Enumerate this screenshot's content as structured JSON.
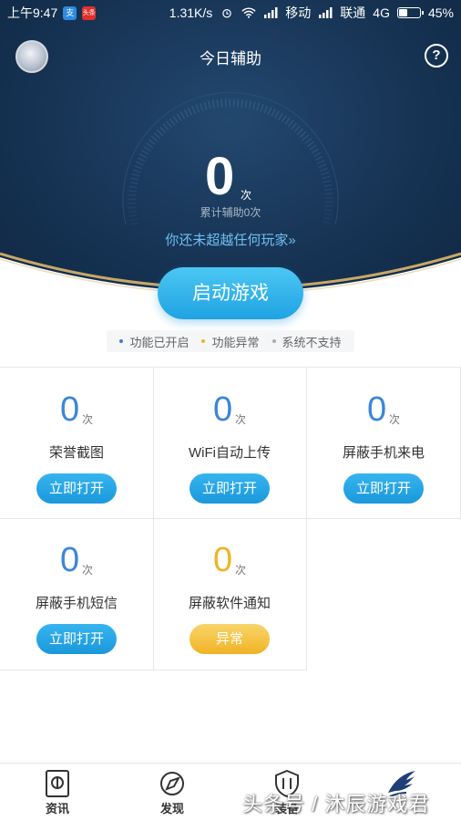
{
  "status_bar": {
    "time": "上午9:47",
    "app_badge_1": "支",
    "app_badge_2": "头条",
    "speed": "1.31K/s",
    "carrier_1": "移动",
    "carrier_2": "联通",
    "network": "4G",
    "battery": "45%",
    "battery_level": 0.45
  },
  "header": {
    "title": "今日辅助",
    "help_symbol": "?"
  },
  "assist_counter": {
    "count": "0",
    "unit": "次",
    "label": "累计辅助0次",
    "link_text": "你还未超越任何玩家",
    "link_arrow": "»"
  },
  "start_button": {
    "label": "启动游戏"
  },
  "legend": [
    {
      "label": "功能已开启",
      "color": "#3b79e0"
    },
    {
      "label": "功能异常",
      "color": "#f0b325"
    },
    {
      "label": "系统不支持",
      "color": "#aaaaaa"
    }
  ],
  "features": [
    {
      "count": "0",
      "unit": "次",
      "name": "荣誉截图",
      "action": "立即打开",
      "state": "open",
      "count_color": "#3b86d8"
    },
    {
      "count": "0",
      "unit": "次",
      "name": "WiFi自动上传",
      "action": "立即打开",
      "state": "open",
      "count_color": "#3b86d8"
    },
    {
      "count": "0",
      "unit": "次",
      "name": "屏蔽手机来电",
      "action": "立即打开",
      "state": "open",
      "count_color": "#3b86d8"
    },
    {
      "count": "0",
      "unit": "次",
      "name": "屏蔽手机短信",
      "action": "立即打开",
      "state": "open",
      "count_color": "#3b86d8"
    },
    {
      "count": "0",
      "unit": "次",
      "name": "屏蔽软件通知",
      "action": "异常",
      "state": "abnormal",
      "count_color": "#f0b325"
    }
  ],
  "bottom_nav": {
    "items": [
      {
        "label": "资讯",
        "icon": "news-book-icon"
      },
      {
        "label": "发现",
        "icon": "compass-icon"
      },
      {
        "label": "装备",
        "icon": "shield-icon"
      },
      {
        "label": "",
        "icon": "wings-logo-icon"
      }
    ]
  },
  "watermark": "头条号 / 沐辰游戏君"
}
